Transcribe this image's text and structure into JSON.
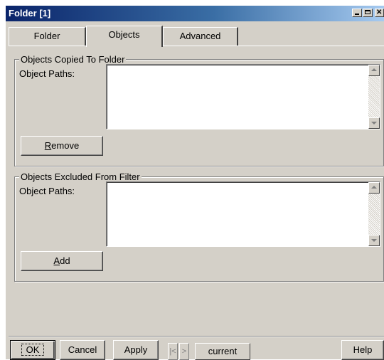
{
  "window": {
    "title": "Folder [1]"
  },
  "tabs": [
    {
      "label": "Folder",
      "selected": false
    },
    {
      "label": "Objects",
      "selected": true
    },
    {
      "label": "Advanced",
      "selected": false
    }
  ],
  "copied_group": {
    "legend": "Objects Copied To Folder",
    "paths_label": "Object Paths:",
    "paths": [],
    "button_label": "Remove",
    "button_mnemonic": "R"
  },
  "excluded_group": {
    "legend": "Objects Excluded From Filter",
    "paths_label": "Object Paths:",
    "paths": [],
    "button_label": "Add",
    "button_mnemonic": "A"
  },
  "footer": {
    "ok_label": "OK",
    "cancel_label": "Cancel",
    "apply_label": "Apply",
    "first_glyph": "|<",
    "prev_glyph": ">",
    "current_label": "current",
    "help_label": "Help"
  },
  "colors": {
    "face": "#d4d0c8",
    "titlebar_start": "#0a246a",
    "titlebar_end": "#a6caf0"
  }
}
